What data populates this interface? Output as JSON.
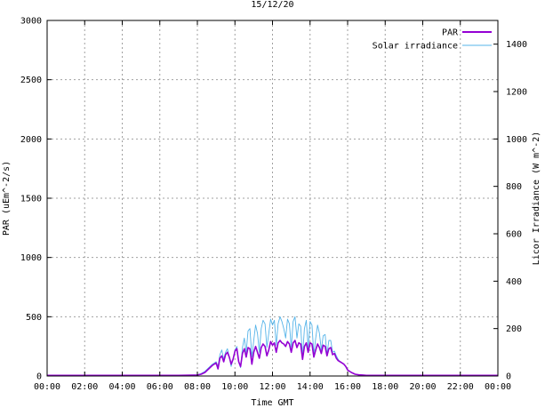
{
  "chart_data": {
    "type": "line",
    "title": "15/12/20",
    "xlabel": "Time GMT",
    "ylabel": "PAR (uEm^-2/s)",
    "y2label": "Licor Irradiance (W m^-2)",
    "xlim": [
      0,
      24
    ],
    "ylim": [
      0,
      3000
    ],
    "y2lim": [
      0,
      1500
    ],
    "x_ticks": [
      0,
      2,
      4,
      6,
      8,
      10,
      12,
      14,
      16,
      18,
      20,
      22,
      24
    ],
    "x_tick_labels": [
      "00:00",
      "02:00",
      "04:00",
      "06:00",
      "08:00",
      "10:00",
      "12:00",
      "14:00",
      "16:00",
      "18:00",
      "20:00",
      "22:00",
      "00:00"
    ],
    "y_ticks": [
      0,
      500,
      1000,
      1500,
      2000,
      2500,
      3000
    ],
    "y_tick_labels": [
      "0",
      "500",
      "1000",
      "1500",
      "2000",
      "2500",
      "3000"
    ],
    "y2_ticks": [
      0,
      200,
      400,
      600,
      800,
      1000,
      1200,
      1400
    ],
    "y2_tick_labels": [
      "0",
      "200",
      "400",
      "600",
      "800",
      "1000",
      "1200",
      "1400"
    ],
    "grid": true,
    "legend_position": "top-right",
    "series": [
      {
        "name": "PAR",
        "axis": "left",
        "color": "#9400d3",
        "x": [
          0,
          1,
          2,
          3,
          4,
          5,
          6,
          7,
          8,
          8.2,
          8.4,
          8.6,
          8.8,
          9.0,
          9.1,
          9.2,
          9.3,
          9.4,
          9.5,
          9.6,
          9.7,
          9.8,
          9.9,
          10.0,
          10.1,
          10.2,
          10.3,
          10.4,
          10.5,
          10.6,
          10.7,
          10.8,
          10.9,
          11.0,
          11.1,
          11.2,
          11.3,
          11.4,
          11.5,
          11.6,
          11.7,
          11.8,
          11.9,
          12.0,
          12.1,
          12.2,
          12.3,
          12.4,
          12.5,
          12.6,
          12.7,
          12.8,
          12.9,
          13.0,
          13.1,
          13.2,
          13.3,
          13.4,
          13.5,
          13.6,
          13.7,
          13.8,
          13.9,
          14.0,
          14.1,
          14.2,
          14.3,
          14.4,
          14.5,
          14.6,
          14.7,
          14.8,
          14.9,
          15.0,
          15.1,
          15.2,
          15.3,
          15.4,
          15.5,
          15.6,
          15.7,
          15.8,
          15.9,
          16.0,
          16.2,
          16.4,
          16.6,
          16.8,
          17,
          18,
          19,
          20,
          21,
          22,
          23,
          24
        ],
        "y": [
          5,
          5,
          5,
          5,
          5,
          5,
          5,
          5,
          8,
          15,
          30,
          60,
          90,
          110,
          60,
          150,
          170,
          120,
          180,
          200,
          160,
          100,
          140,
          210,
          230,
          120,
          80,
          190,
          230,
          160,
          240,
          230,
          100,
          200,
          250,
          200,
          150,
          240,
          270,
          250,
          170,
          220,
          290,
          260,
          280,
          200,
          280,
          300,
          280,
          270,
          250,
          290,
          270,
          200,
          280,
          300,
          240,
          280,
          270,
          140,
          250,
          280,
          200,
          280,
          270,
          160,
          220,
          270,
          240,
          190,
          260,
          250,
          170,
          230,
          240,
          180,
          190,
          150,
          130,
          120,
          110,
          100,
          80,
          50,
          30,
          15,
          10,
          8,
          5,
          5,
          5,
          5,
          5,
          5,
          5,
          5
        ]
      },
      {
        "name": "Solar irradiance",
        "axis": "right",
        "color": "#56b4e9",
        "x": [
          0,
          1,
          2,
          3,
          4,
          5,
          6,
          7,
          8,
          8.2,
          8.4,
          8.6,
          8.8,
          9.0,
          9.1,
          9.2,
          9.3,
          9.4,
          9.5,
          9.6,
          9.7,
          9.8,
          9.9,
          10.0,
          10.1,
          10.2,
          10.3,
          10.4,
          10.5,
          10.6,
          10.7,
          10.8,
          10.9,
          11.0,
          11.1,
          11.2,
          11.3,
          11.4,
          11.5,
          11.6,
          11.7,
          11.8,
          11.9,
          12.0,
          12.1,
          12.2,
          12.3,
          12.4,
          12.5,
          12.6,
          12.7,
          12.8,
          12.9,
          13.0,
          13.1,
          13.2,
          13.3,
          13.4,
          13.5,
          13.6,
          13.7,
          13.8,
          13.9,
          14.0,
          14.1,
          14.2,
          14.3,
          14.4,
          14.5,
          14.6,
          14.7,
          14.8,
          14.9,
          15.0,
          15.1,
          15.2,
          15.3,
          15.4,
          15.5,
          15.6,
          15.7,
          15.8,
          15.9,
          16.0,
          16.2,
          16.4,
          16.6,
          16.8,
          17,
          18,
          19,
          20,
          21,
          22,
          23,
          24
        ],
        "y": [
          2,
          2,
          2,
          2,
          2,
          2,
          2,
          2,
          5,
          10,
          20,
          35,
          50,
          60,
          40,
          90,
          110,
          70,
          100,
          115,
          80,
          40,
          70,
          110,
          125,
          60,
          35,
          120,
          160,
          100,
          190,
          200,
          80,
          150,
          215,
          180,
          100,
          200,
          235,
          220,
          120,
          180,
          240,
          215,
          235,
          130,
          220,
          250,
          230,
          200,
          160,
          240,
          220,
          120,
          230,
          250,
          160,
          220,
          210,
          80,
          200,
          235,
          120,
          230,
          215,
          90,
          160,
          215,
          180,
          110,
          170,
          175,
          90,
          150,
          150,
          100,
          105,
          85,
          70,
          60,
          55,
          50,
          40,
          25,
          15,
          8,
          5,
          4,
          2,
          2,
          2,
          2,
          2,
          2,
          2,
          2
        ]
      }
    ]
  }
}
